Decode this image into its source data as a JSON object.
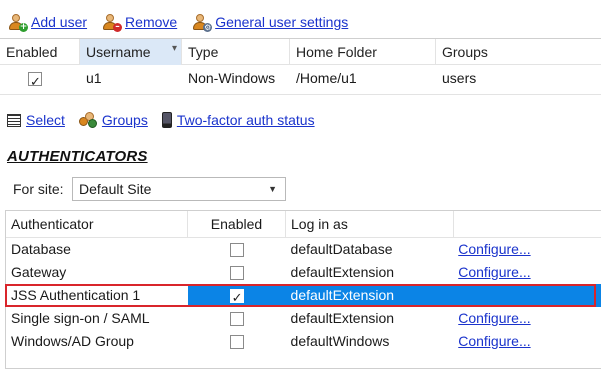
{
  "toolbar": {
    "add_user": "Add user",
    "remove": "Remove",
    "general_settings": "General user settings"
  },
  "users_table": {
    "headers": [
      "Enabled",
      "Username",
      "Type",
      "Home Folder",
      "Groups"
    ],
    "rows": [
      {
        "enabled": true,
        "username": "u1",
        "type": "Non-Windows",
        "home_folder": "/Home/u1",
        "groups": "users"
      }
    ]
  },
  "toolbar2": {
    "select": "Select",
    "groups": "Groups",
    "two_factor": "Two-factor auth status"
  },
  "section_title": "AUTHENTICATORS",
  "site": {
    "label": "For site:",
    "value": "Default Site"
  },
  "auth_table": {
    "headers": [
      "Authenticator",
      "Enabled",
      "Log in as"
    ],
    "rows": [
      {
        "name": "Database",
        "enabled": false,
        "login_as": "defaultDatabase",
        "configure": "Configure..."
      },
      {
        "name": "Gateway",
        "enabled": false,
        "login_as": "defaultExtension",
        "configure": "Configure..."
      },
      {
        "name": "JSS Authentication 1",
        "enabled": true,
        "login_as": "defaultExtension",
        "configure": ""
      },
      {
        "name": "Single sign-on / SAML",
        "enabled": false,
        "login_as": "defaultExtension",
        "configure": "Configure..."
      },
      {
        "name": "Windows/AD Group",
        "enabled": false,
        "login_as": "defaultWindows",
        "configure": "Configure..."
      }
    ]
  },
  "colors": {
    "link": "#1a33cc",
    "selection": "#0b84e6",
    "highlight_border": "#d9252b"
  }
}
